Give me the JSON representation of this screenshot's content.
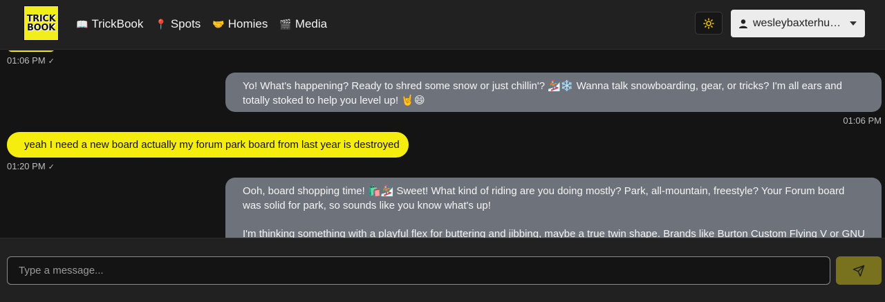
{
  "brand": {
    "logo_line1": "TRICK",
    "logo_line2": "BOOK"
  },
  "nav": [
    {
      "icon": "📖",
      "label": "TrickBook"
    },
    {
      "icon": "📍",
      "label": "Spots"
    },
    {
      "icon": "🤝",
      "label": "Homies"
    },
    {
      "icon": "🎬",
      "label": "Media"
    }
  ],
  "user": {
    "name": "wesleybaxterhuber"
  },
  "messages": [
    {
      "role": "user",
      "text": "",
      "time": "01:06 PM",
      "read": "✓"
    },
    {
      "role": "assistant",
      "text": "Yo! What's happening? Ready to shred some snow or just chillin'? 🏂❄️ Wanna talk snowboarding, gear, or tricks? I'm all ears and totally stoked to help you level up! 🤘😄",
      "time": "01:06 PM"
    },
    {
      "role": "user",
      "text": "yeah I need a new board actually my forum park board from last year is destroyed",
      "time": "01:20 PM",
      "read": "✓"
    },
    {
      "role": "assistant",
      "text_p1": "Ooh, board shopping time! 🛍️🏂 Sweet! What kind of riding are you doing mostly? Park, all-mountain, freestyle? Your Forum board was solid for park, so sounds like you know what's up!",
      "text_p2": "I'm thinking something with a playful flex for buttering and jibbing, maybe a true twin shape. Brands like Burton Custom Flying V or GNU"
    }
  ],
  "composer": {
    "placeholder": "Type a message..."
  },
  "colors": {
    "accent": "#f5ed0e",
    "ai_bubble": "#6e737b",
    "send": "#78721e"
  }
}
